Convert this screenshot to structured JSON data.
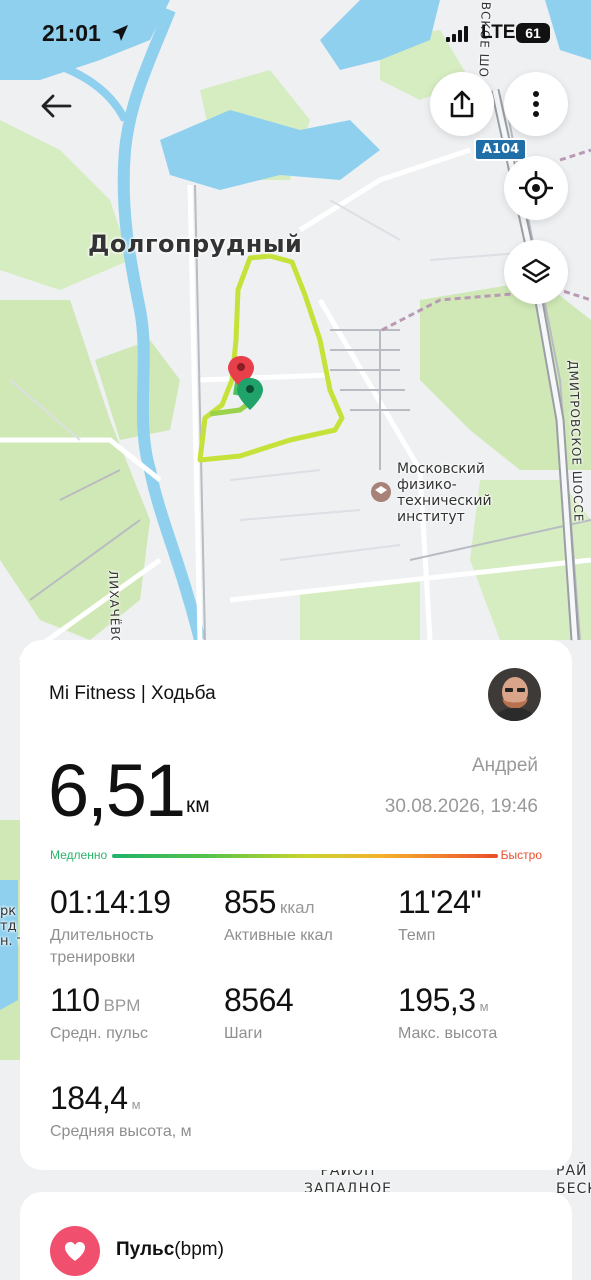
{
  "status_bar": {
    "time": "21:01",
    "network": "LTE",
    "battery": "61"
  },
  "map": {
    "city_label": "Долгопрудный",
    "road_badge": "A104",
    "street_left": "ЛИХАЧЁВСКИЙ ПРОСП",
    "street_right": "ДМИТРОВСКОЕ ШОССЕ",
    "street_top": "ВСКОЕ ШО",
    "institute_line1": "Московский",
    "institute_line2": "физико-",
    "institute_line3": "технический",
    "institute_line4": "институт",
    "district_line1": "РАЙОН",
    "district_line2": "ЗАПАДНОЕ",
    "district_right1": "РАЙ",
    "district_right2": "БЕСКУНИН",
    "left_edge_text": [
      "рк",
      "тд",
      "н. т"
    ]
  },
  "workout": {
    "app_and_type": "Mi Fitness | Ходьба",
    "distance": "6,51",
    "distance_unit": "км",
    "user_name": "Андрей",
    "datetime": "30.08.2026, 19:46",
    "speed_slow": "Медленно",
    "speed_fast": "Быстро",
    "stats": [
      {
        "value": "01:14:19",
        "unit": "",
        "label": "Длительность тренировки"
      },
      {
        "value": "855",
        "unit": "ккал",
        "label": "Активные ккал"
      },
      {
        "value": "11'24\"",
        "unit": "",
        "label": "Темп"
      },
      {
        "value": "110",
        "unit": "BPM",
        "label": "Средн. пульс"
      },
      {
        "value": "8564",
        "unit": "",
        "label": "Шаги"
      },
      {
        "value": "195,3",
        "unit": "м",
        "label": "Макс. высота"
      },
      {
        "value": "184,4",
        "unit": "м",
        "label": "Средняя высота, м"
      }
    ]
  },
  "pulse_section": {
    "title": "Пульс",
    "unit": "(bpm)"
  },
  "colors": {
    "route": "#c6e23a",
    "start_pin": "#1fa36b",
    "end_pin": "#e8404a",
    "water": "#8fd0ef"
  }
}
